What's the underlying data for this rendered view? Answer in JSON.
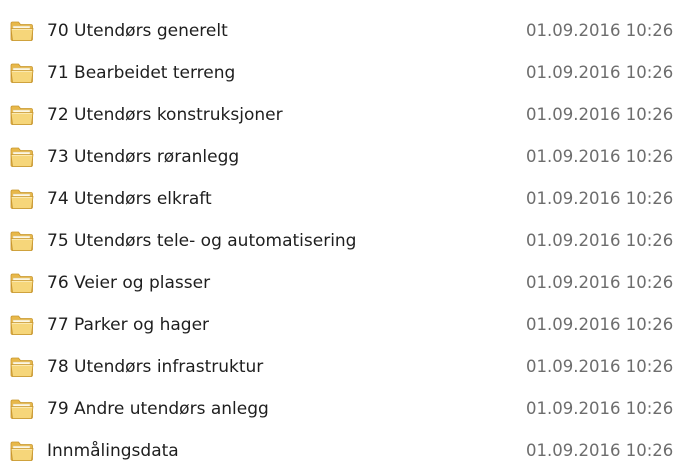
{
  "file_list": {
    "items": [
      {
        "name": "70 Utendørs generelt",
        "date_modified": "01.09.2016 10:26",
        "icon": "folder-icon"
      },
      {
        "name": "71 Bearbeidet terreng",
        "date_modified": "01.09.2016 10:26",
        "icon": "folder-icon"
      },
      {
        "name": "72 Utendørs konstruksjoner",
        "date_modified": "01.09.2016 10:26",
        "icon": "folder-icon"
      },
      {
        "name": "73 Utendørs røranlegg",
        "date_modified": "01.09.2016 10:26",
        "icon": "folder-icon"
      },
      {
        "name": "74 Utendørs elkraft",
        "date_modified": "01.09.2016 10:26",
        "icon": "folder-icon"
      },
      {
        "name": "75 Utendørs tele- og automatisering",
        "date_modified": "01.09.2016 10:26",
        "icon": "folder-icon"
      },
      {
        "name": "76 Veier og plasser",
        "date_modified": "01.09.2016 10:26",
        "icon": "folder-icon"
      },
      {
        "name": "77 Parker og hager",
        "date_modified": "01.09.2016 10:26",
        "icon": "folder-icon"
      },
      {
        "name": "78 Utendørs infrastruktur",
        "date_modified": "01.09.2016 10:26",
        "icon": "folder-icon"
      },
      {
        "name": "79 Andre utendørs anlegg",
        "date_modified": "01.09.2016 10:26",
        "icon": "folder-icon"
      },
      {
        "name": "Innmålingsdata",
        "date_modified": "01.09.2016 10:26",
        "icon": "folder-icon"
      }
    ]
  },
  "colors": {
    "folder_body": "#e8b84a",
    "folder_front": "#f6d67a",
    "name_text": "#1e1e1e",
    "date_text": "#6d6d6d"
  }
}
